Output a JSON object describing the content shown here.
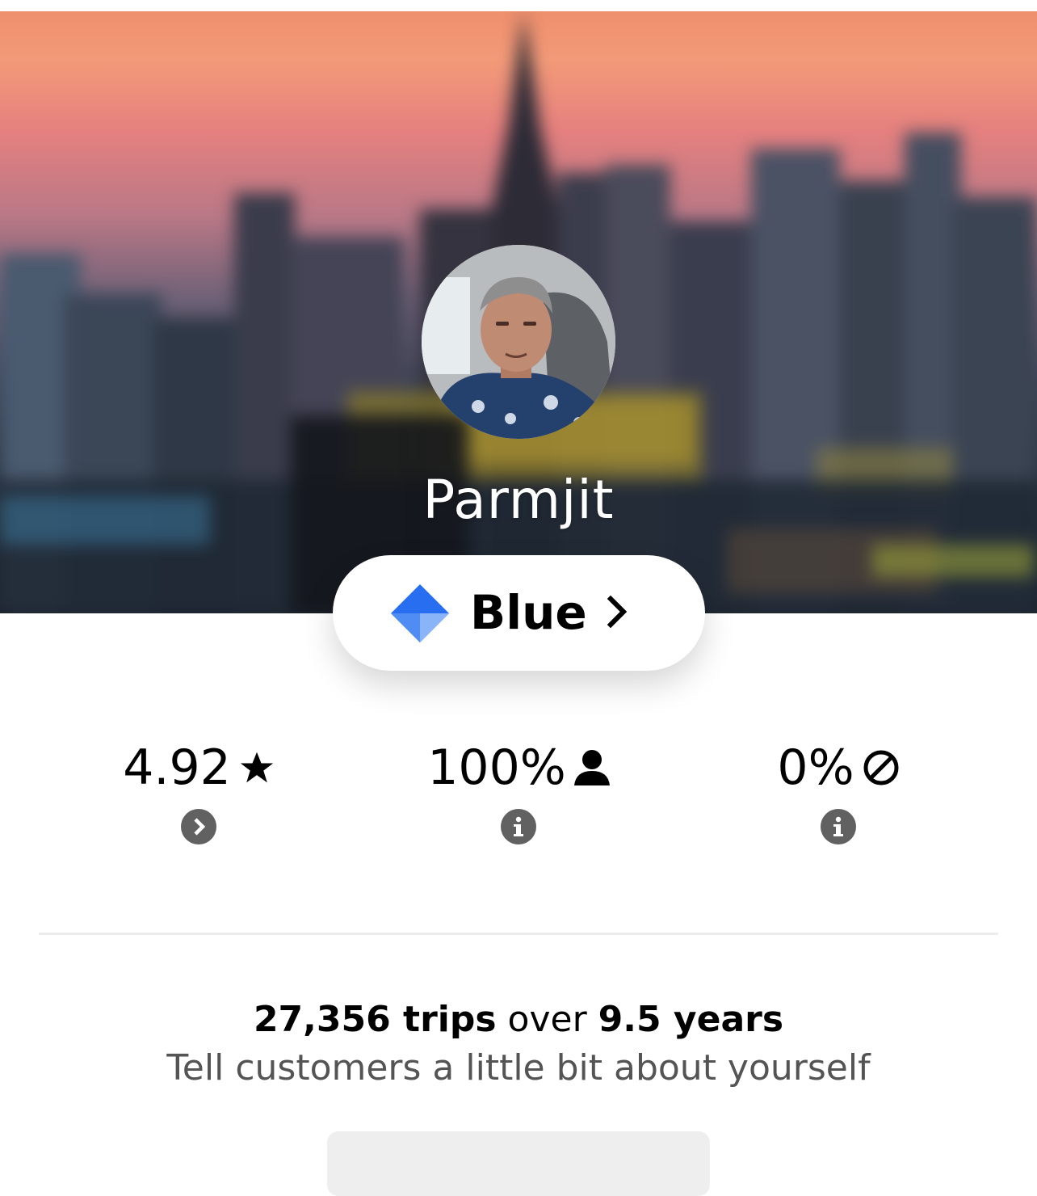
{
  "profile": {
    "name": "Parmjit",
    "avatar_alt": "driver profile photo",
    "cover_image": "city skyline at sunset"
  },
  "tier": {
    "label": "Blue",
    "icon": "blue-diamond-icon",
    "chevron_icon": "chevron-right-icon",
    "color": "#276ef1"
  },
  "stats": [
    {
      "value": "4.92",
      "icon": "star-icon",
      "action_icon": "chevron-right-icon"
    },
    {
      "value": "100%",
      "icon": "person-icon",
      "action_icon": "info-icon"
    },
    {
      "value": "0%",
      "icon": "cancel-icon",
      "action_icon": "info-icon"
    }
  ],
  "trips": {
    "count": "27,356 trips",
    "connector": "over",
    "duration": "9.5 years"
  },
  "bio_prompt": "Tell customers a little bit about yourself",
  "colors": {
    "accent_blue": "#276ef1",
    "icon_gray": "#616161",
    "secondary_text": "#545454"
  }
}
